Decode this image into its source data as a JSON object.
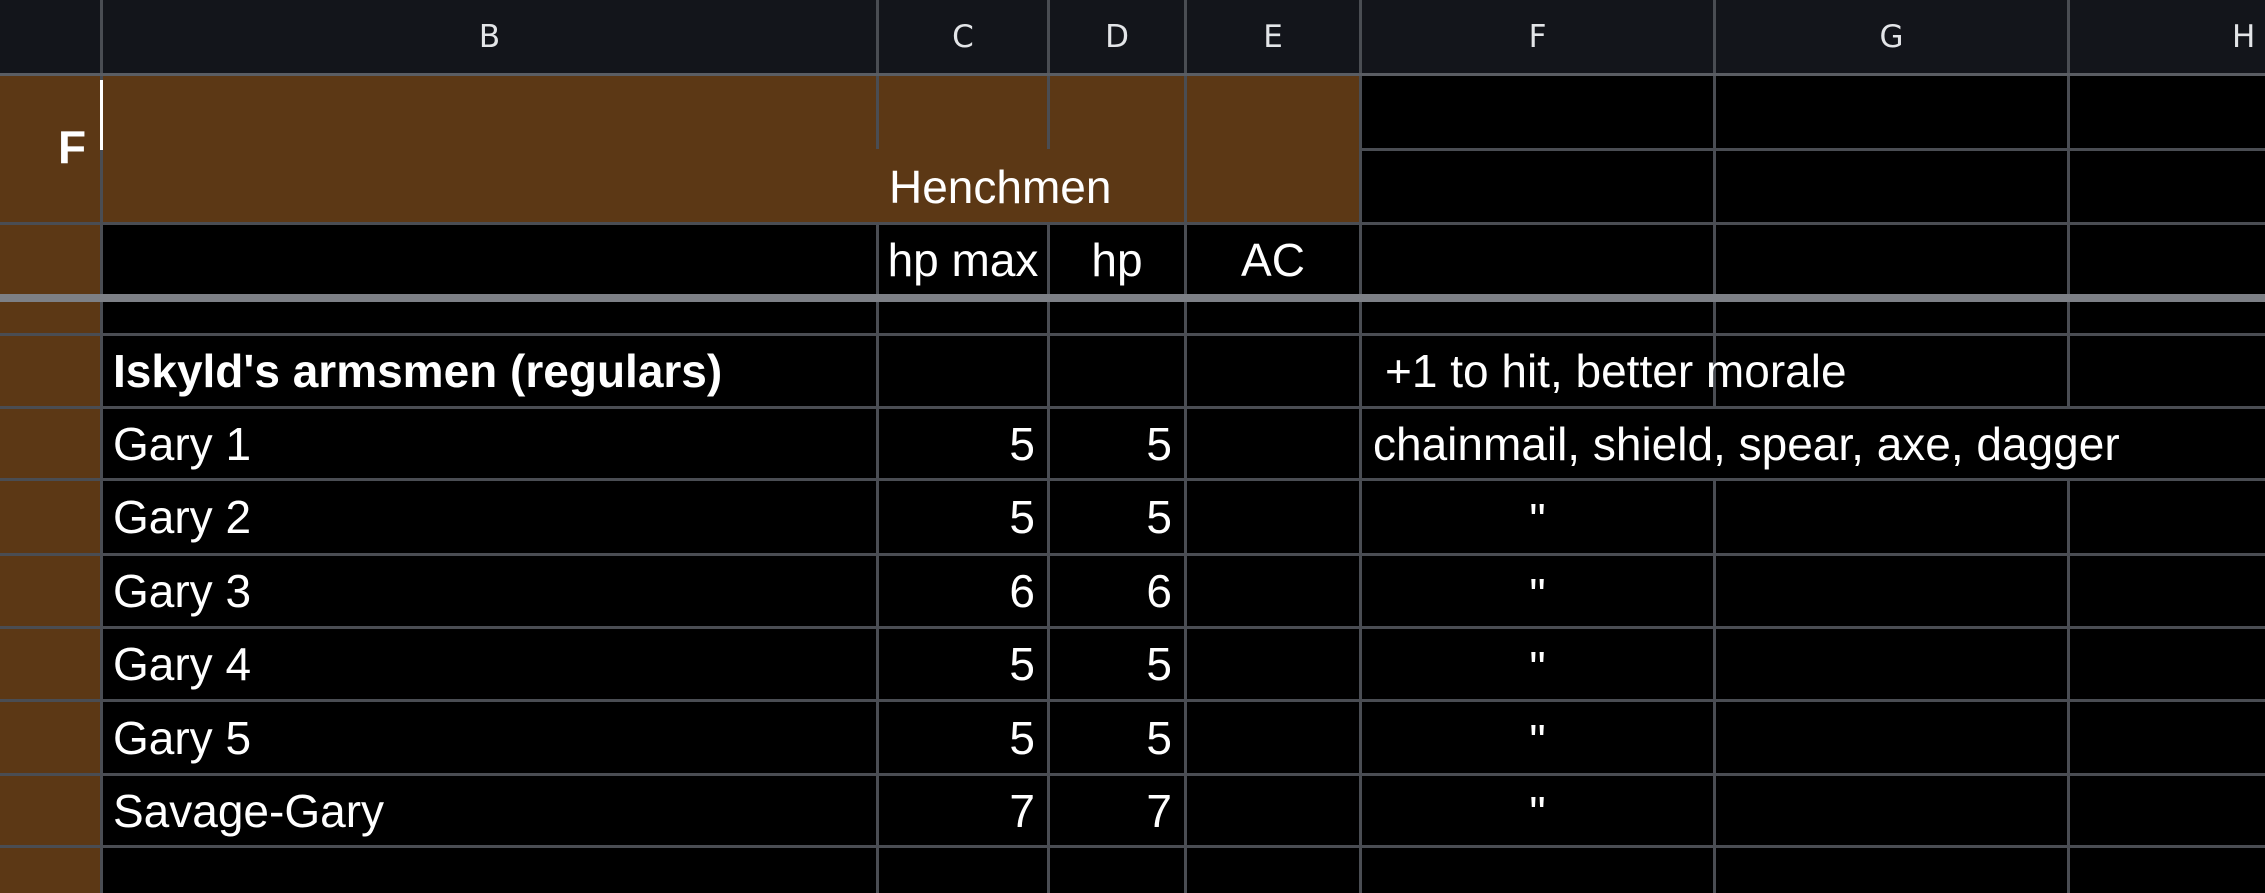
{
  "columns": {
    "a": "",
    "b": "B",
    "c": "C",
    "d": "D",
    "e": "E",
    "f": "F",
    "g": "G",
    "h": "H"
  },
  "freeze_indicator": "F",
  "header": {
    "title": "Henchmen",
    "hp_max": "hp max",
    "hp": "hp",
    "ac": "AC"
  },
  "section": {
    "title": "Iskyld's armsmen (regulars)",
    "note": "+1 to hit, better morale"
  },
  "rows": [
    {
      "name": "Gary 1",
      "hp_max": "5",
      "hp": "5",
      "notes": "chainmail, shield, spear, axe, dagger"
    },
    {
      "name": "Gary 2",
      "hp_max": "5",
      "hp": "5",
      "notes": "\""
    },
    {
      "name": "Gary 3",
      "hp_max": "6",
      "hp": "6",
      "notes": "\""
    },
    {
      "name": "Gary 4",
      "hp_max": "5",
      "hp": "5",
      "notes": "\""
    },
    {
      "name": "Gary 5",
      "hp_max": "5",
      "hp": "5",
      "notes": "\""
    },
    {
      "name": "Savage-Gary",
      "hp_max": "7",
      "hp": "7",
      "notes": "\""
    }
  ],
  "colors": {
    "header_bg": "#13151b",
    "brown_fill": "#5c3815",
    "cell_bg": "#000000",
    "grid_line": "#4a4d53",
    "freeze_line": "#7d8086",
    "text": "#ffffff"
  }
}
